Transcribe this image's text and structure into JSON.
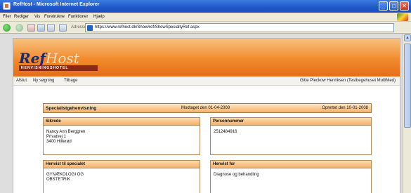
{
  "window": {
    "title": "RefHost - Microsoft Internet Explorer",
    "min": "_",
    "max": "□",
    "close": "✕"
  },
  "menu": [
    "Filer",
    "Rediger",
    "Vis",
    "Foretrukne",
    "Funktioner",
    "Hjælp"
  ],
  "toolbar": {
    "address_label": "Adresse",
    "url": "https://www.refhost.dk/Show/ref/ShowSpecialtyRef.aspx"
  },
  "logo": {
    "ref": "Ref",
    "host": "Host",
    "sub": "HENVISNINGSHOTEL"
  },
  "nav": {
    "links": [
      "Afslut",
      "Ny søgning",
      "Tilbage"
    ],
    "user": "Gitte Pleckow Henriksen (Testbegehuset MultiMed)"
  },
  "referral": {
    "heading": "Specialistgehenvisning",
    "received": "Modtaget den 01-04-2008",
    "created": "Oprettet den 10-01-2008"
  },
  "sikrede": {
    "header": "Sikrede",
    "name": "Nancy Ann Berggren",
    "street": "Privatvej 1",
    "city": "3400 Hillerød"
  },
  "personnummer": {
    "header": "Personnummer",
    "value": "2512484916"
  },
  "henvist_til": {
    "header": "Henvist til specialet",
    "line1": "GYNÆKOLOGI OG",
    "line2": "OBSTETRIK"
  },
  "henvist_for": {
    "header": "Henvist for",
    "value": "Diagnose og behandling"
  }
}
